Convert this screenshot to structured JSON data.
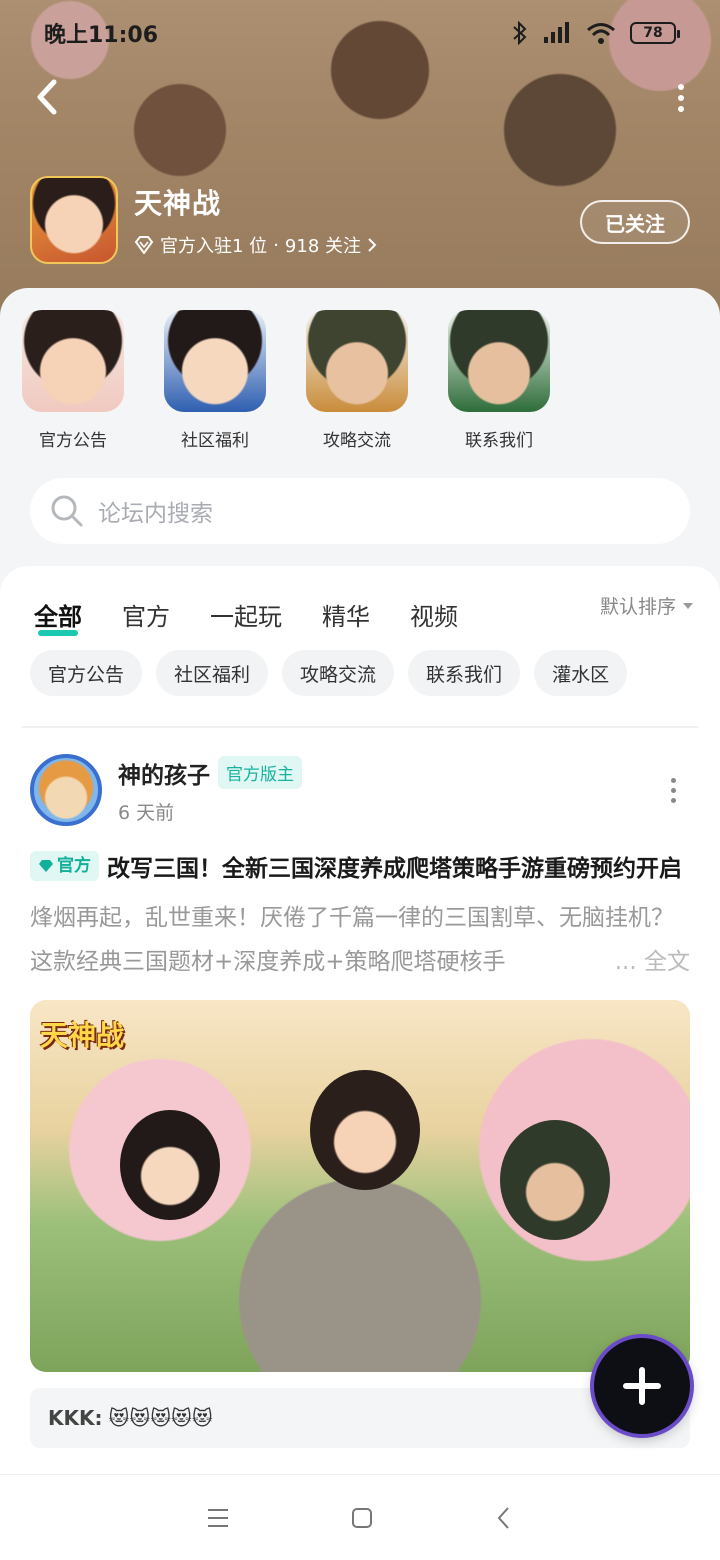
{
  "status": {
    "time": "晚上11:06",
    "battery": "78"
  },
  "game": {
    "name": "天神战",
    "meta_official": "官方入驻1 位",
    "meta_dot": "·",
    "meta_follow": "918 关注",
    "follow_label": "已关注"
  },
  "sections": [
    {
      "label": "官方公告"
    },
    {
      "label": "社区福利"
    },
    {
      "label": "攻略交流"
    },
    {
      "label": "联系我们"
    }
  ],
  "search": {
    "placeholder": "论坛内搜索"
  },
  "tabs": [
    {
      "label": "全部",
      "active": true
    },
    {
      "label": "官方"
    },
    {
      "label": "一起玩"
    },
    {
      "label": "精华"
    },
    {
      "label": "视频"
    }
  ],
  "sort_label": "默认排序",
  "chips": [
    "官方公告",
    "社区福利",
    "攻略交流",
    "联系我们",
    "灌水区"
  ],
  "post": {
    "author": "神的孩子",
    "badge": "官方版主",
    "time": "6 天前",
    "official_tag": "官方",
    "title": "改写三国！全新三国深度养成爬塔策略手游重磅预约开启",
    "body": "烽烟再起，乱世重来！厌倦了千篇一律的三国割草、无脑挂机？这款经典三国题材+深度养成+策略爬塔硬核手",
    "more_link": "... 全文",
    "image_logo": "天神战",
    "comment_user": "KKK:",
    "comment_text": "😻😻😻😻😻"
  },
  "colors": {
    "accent": "#1bc8b0",
    "badge_text": "#17b39f"
  }
}
